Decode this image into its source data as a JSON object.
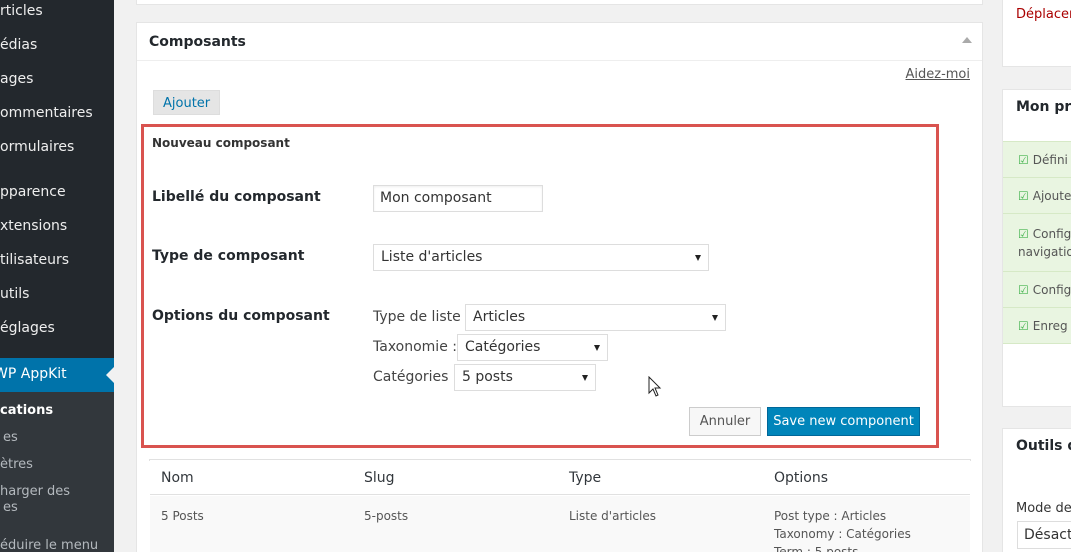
{
  "sidebar": {
    "items": [
      "rticles",
      "édias",
      "ages",
      "ommentaires",
      "ormulaires",
      "pparence",
      "xtensions",
      "tilisateurs",
      "utils",
      "églages"
    ],
    "active": "WP AppKit",
    "submenu": [
      "cations",
      "es",
      "ètres",
      "harger des",
      "es"
    ],
    "collapse": "éduire le menu"
  },
  "main": {
    "title": "Composants",
    "help": "Aidez-moi",
    "add_button": "Ajouter",
    "form": {
      "title": "Nouveau composant",
      "label_label": "Libellé du composant",
      "label_value": "Mon composant",
      "type_label": "Type de composant",
      "type_value": "Liste d'articles",
      "options_label": "Options du composant",
      "list_type_label": "Type de liste :",
      "list_type_value": "Articles",
      "taxonomy_label": "Taxonomie :",
      "taxonomy_value": "Catégories",
      "categories_label": "Catégories :",
      "categories_value": "5 posts",
      "cancel": "Annuler",
      "save": "Save new component"
    },
    "table": {
      "headers": [
        "Nom",
        "Slug",
        "Type",
        "Options"
      ],
      "row": {
        "name": "5 Posts",
        "slug": "5-posts",
        "type": "Liste d'articles",
        "options": [
          "Post type : Articles",
          "Taxonomy : Catégories",
          "Term : 5 posts"
        ]
      }
    }
  },
  "right": {
    "move": "Déplacer",
    "progress_title": "Mon pro",
    "checks": [
      "Défini",
      "Ajoute",
      "Config",
      "navigatio",
      "Config",
      "Enreg"
    ],
    "tools_title": "Outils de",
    "mode_label": "Mode de",
    "mode_value": "Désacti"
  },
  "colors": {
    "sidebar": "#23282d",
    "active": "#0073aa",
    "highlight_border": "#d9534f",
    "primary_button": "#0085ba",
    "check_bg": "#e9f5e1"
  }
}
